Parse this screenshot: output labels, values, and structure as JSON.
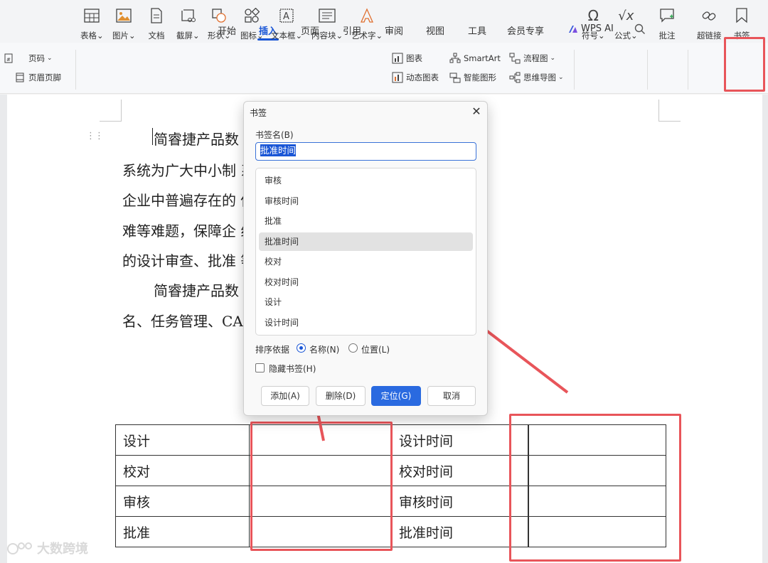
{
  "ribbon": {
    "tabs": [
      "开始",
      "插入",
      "页面",
      "引用",
      "审阅",
      "视图",
      "工具",
      "会员专享",
      "WPS AI"
    ],
    "active_tab": "插入"
  },
  "toolbar": {
    "page_number": "页码",
    "header_footer": "页眉页脚",
    "table": "表格",
    "picture": "图片",
    "document": "文档",
    "screenshot": "截屏",
    "shape": "形状",
    "icon": "图标",
    "textbox": "文本框",
    "content_block": "内容块",
    "wordart": "艺术字",
    "chart": "图表",
    "dynamic_chart": "动态图表",
    "smartart": "SmartArt",
    "smart_shape": "智能图形",
    "flowchart": "流程图",
    "mindmap": "思维导图",
    "symbol": "符号",
    "formula": "公式",
    "comment": "批注",
    "hyperlink": "超链接",
    "bookmark": "书签"
  },
  "document": {
    "lines": [
      "简睿捷产品数                                    方案的一个重要组成部分。",
      "系统为广大中小制                                系统的解决方案，重点解决",
      "企业中普遍存在的                                借用关系不明确、查询困",
      "难等难题，保障企                                组织整个产品生命周期内",
      "的设计审查、批准                                等管理过程。",
      "简睿捷产品数                                    理、产品结构管理、电子签",
      "名、任务管理、CA"
    ],
    "table": [
      [
        "设计",
        "",
        "设计时间",
        "",
        ""
      ],
      [
        "校对",
        "",
        "校对时间",
        "",
        ""
      ],
      [
        "审核",
        "",
        "审核时间",
        "",
        ""
      ],
      [
        "批准",
        "",
        "批准时间",
        "",
        ""
      ]
    ]
  },
  "dialog": {
    "title": "书签",
    "name_label": "书签名(B)",
    "name_value": "批准时间",
    "bookmarks": [
      "审核",
      "审核时间",
      "批准",
      "批准时间",
      "校对",
      "校对时间",
      "设计",
      "设计时间"
    ],
    "selected_bookmark": "批准时间",
    "sort_label": "排序依据",
    "sort_by_name": "名称(N)",
    "sort_by_position": "位置(L)",
    "sort_selected": "名称(N)",
    "hidden_label": "隐藏书签(H)",
    "hidden_checked": false,
    "add_button": "添加(A)",
    "delete_button": "删除(D)",
    "goto_button": "定位(G)",
    "cancel_button": "取消"
  },
  "watermark": "大数跨境",
  "colors": {
    "accent": "#1a56d6",
    "annotation_red": "#e8555a",
    "primary_button": "#2a6ae0"
  }
}
